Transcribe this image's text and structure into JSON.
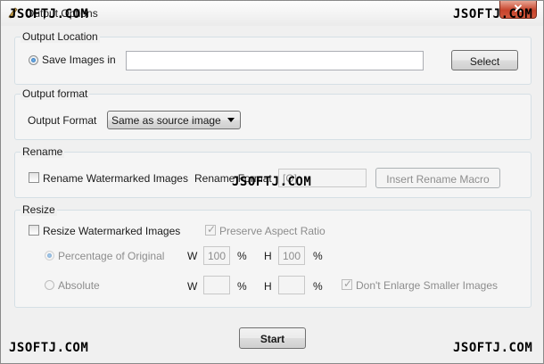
{
  "window": {
    "title": "Output Options",
    "close_glyph": "✕"
  },
  "watermarks": {
    "text": "JSOFTJ.COM"
  },
  "output_location": {
    "group_title": "Output Location",
    "radio_label": "Save Images in",
    "path_value": "",
    "select_button": "Select"
  },
  "output_format": {
    "group_title": "Output format",
    "label": "Output Format",
    "selected": "Same as source image"
  },
  "rename": {
    "group_title": "Rename",
    "checkbox_label": "Rename Watermarked Images",
    "format_label": "Rename Format",
    "format_value": "[O]",
    "macro_button": "Insert Rename Macro"
  },
  "resize": {
    "group_title": "Resize",
    "checkbox_label": "Resize Watermarked Images",
    "preserve_label": "Preserve Aspect Ratio",
    "percentage_label": "Percentage of Original",
    "absolute_label": "Absolute",
    "w_label": "W",
    "h_label": "H",
    "pct_unit": "%",
    "pct_w": "100",
    "pct_h": "100",
    "abs_w": "",
    "abs_h": "",
    "dont_enlarge_label": "Don't Enlarge Smaller Images"
  },
  "footer": {
    "start_button": "Start"
  }
}
